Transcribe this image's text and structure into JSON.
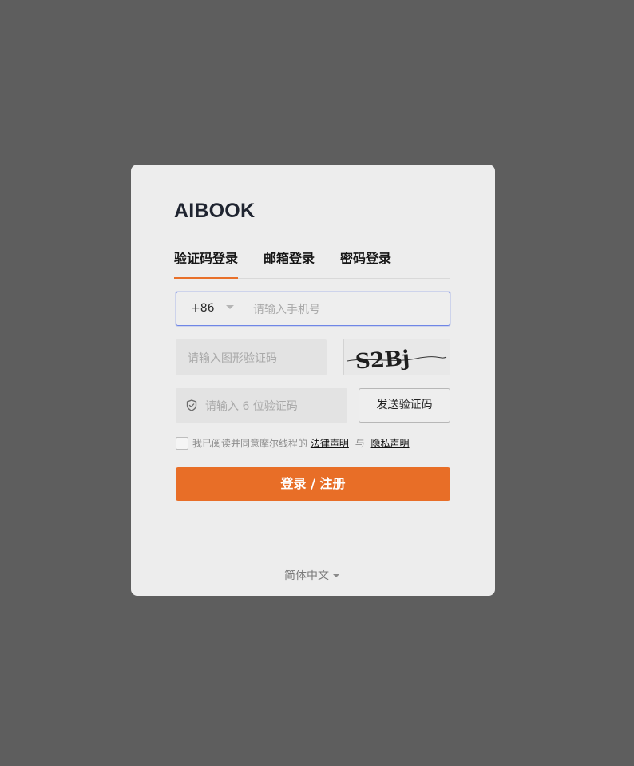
{
  "brand": {
    "title": "AIBOOK"
  },
  "tabs": [
    {
      "label": "验证码登录",
      "active": true
    },
    {
      "label": "邮箱登录",
      "active": false
    },
    {
      "label": "密码登录",
      "active": false
    }
  ],
  "phone": {
    "country_code": "+86",
    "placeholder": "请输入手机号",
    "value": ""
  },
  "captcha": {
    "placeholder": "请输入图形验证码",
    "value": "",
    "image_text": "S2Bj"
  },
  "sms": {
    "placeholder": "请输入 6 位验证码",
    "value": "",
    "send_label": "发送验证码"
  },
  "agreement": {
    "checked": false,
    "prefix": "我已阅读并同意摩尔线程的",
    "legal_link": "法律声明",
    "conjunction": "与",
    "privacy_link": "隐私声明"
  },
  "submit": {
    "label": "登录 / 注册"
  },
  "language": {
    "selected": "简体中文"
  },
  "colors": {
    "accent": "#e86e27",
    "focus_border": "#6f86e6",
    "backdrop": "#5e5e5e",
    "card": "#ededed"
  },
  "icons": {
    "shield": "shield-check-icon",
    "caret": "chevron-down-icon"
  }
}
